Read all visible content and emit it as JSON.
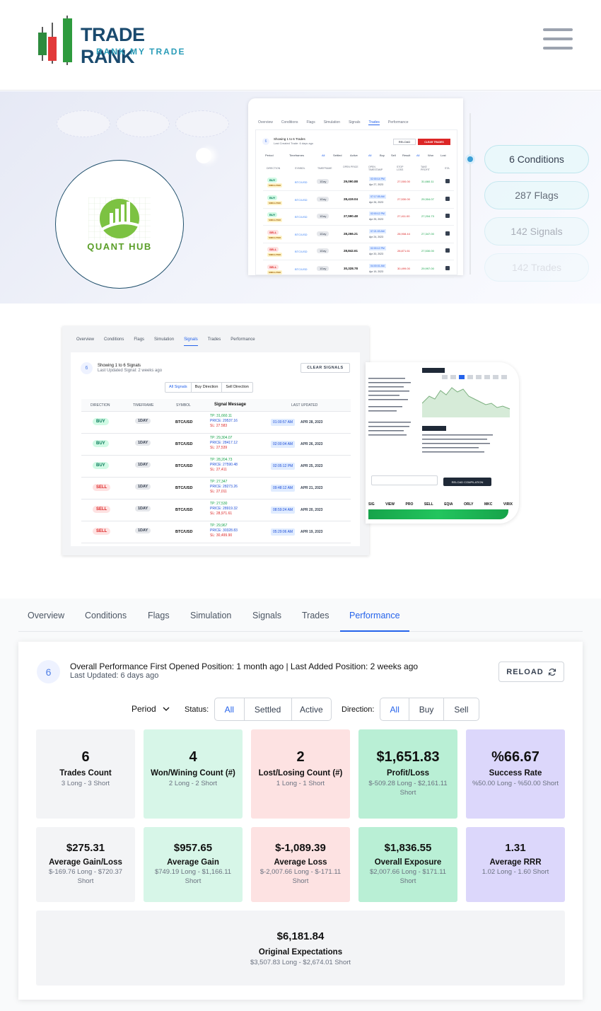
{
  "header": {
    "brand_name": "TRADE RANK",
    "brand_tagline": "RANK MY TRADE",
    "menu_icon": "hamburger-menu-icon"
  },
  "hero": {
    "partner_logo_text": "QUANT HUB",
    "pills": [
      "6 Conditions",
      "287 Flags",
      "142 Signals",
      "142 Trades"
    ],
    "trades_preview": {
      "tabs": [
        "Overview",
        "Conditions",
        "Flags",
        "Simulation",
        "Signals",
        "Trades",
        "Performance"
      ],
      "active_tab": "Trades",
      "count": "6",
      "title": "Showing 1 to 6 Trades",
      "subtitle": "Last Created Trade: 6 days ago",
      "reload_label": "RELOAD",
      "clear_label": "CLEAR TRADES",
      "filters": [
        "Period",
        "Timeframes",
        "All",
        "Settled",
        "Active",
        "All",
        "Buy",
        "Sell",
        "Result",
        "All",
        "Won",
        "Lost"
      ],
      "columns": [
        "DIRECTION",
        "SYMBOL",
        "TIMEFRAME",
        "OPEN PRICE",
        "OPEN TIMESTAMP",
        "STOP LOSS",
        "TAKE PROFIT",
        "STA"
      ],
      "rows": [
        {
          "dir": "BUY",
          "tag": "SIMULATED",
          "symbol": "BTC/USD",
          "tf": "1Day",
          "price": "29,090.88",
          "time": "02:00:14 PM",
          "date": "Apr 27, 2023",
          "sl": "27,000.00",
          "tp": "31,660.11"
        },
        {
          "dir": "BUY",
          "tag": "SIMULATED",
          "symbol": "BTC/USD",
          "tf": "1Day",
          "price": "28,419.04",
          "time": "07:17:05 AM",
          "date": "Apr 26, 2023",
          "sl": "27,530.00",
          "tp": "29,304.07"
        },
        {
          "dir": "BUY",
          "tag": "SIMULATED",
          "symbol": "BTC/USD",
          "tf": "1Day",
          "price": "27,590.48",
          "time": "02:00:12 PM",
          "date": "Apr 25, 2023",
          "sl": "27,411.00",
          "tp": "27,204.73"
        },
        {
          "dir": "SELL",
          "tag": "SIMULATED",
          "symbol": "BTC/USD",
          "tf": "1Day",
          "price": "28,266.21",
          "time": "07:21:03 AM",
          "date": "Apr 24, 2023",
          "sl": "28,908.44",
          "tp": "27,347.00"
        },
        {
          "dir": "SELL",
          "tag": "SIMULATED",
          "symbol": "BTC/USD",
          "tf": "1Day",
          "price": "28,842.61",
          "time": "02:00:12 PM",
          "date": "Apr 20, 2023",
          "sl": "28,871.61",
          "tp": "27,530.00"
        },
        {
          "dir": "SELL",
          "tag": "SIMULATED",
          "symbol": "BTC/USD",
          "tf": "1Day",
          "price": "30,328.78",
          "time": "04:00:01 AM",
          "date": "Apr 19, 2023",
          "sl": "30,499.00",
          "tp": "29,997.00"
        }
      ]
    }
  },
  "signals_preview": {
    "tabs": [
      "Overview",
      "Conditions",
      "Flags",
      "Simulation",
      "Signals",
      "Trades",
      "Performance"
    ],
    "active_tab": "Signals",
    "count": "6",
    "title": "Showing 1 to 6 Signals",
    "subtitle": "Last Updated Signal: 2 weeks ago",
    "clear_label": "CLEAR SIGNALS",
    "filters": [
      "All Signals",
      "Buy Direction",
      "Sell Direction"
    ],
    "columns": [
      "DIRECTION",
      "TIMEFRAME",
      "SYMBOL",
      "Signal Message",
      "LAST UPDATED"
    ],
    "rows": [
      {
        "dir": "BUY",
        "tf": "1DAY",
        "symbol": "BTC/USD",
        "tp": "TP: 31,660.11",
        "price": "PRICE: 29537.16",
        "sl": "SL: 27.583",
        "time": "01:00:57 AM",
        "date": "APR 28, 2023"
      },
      {
        "dir": "BUY",
        "tf": "1DAY",
        "symbol": "BTC/USD",
        "tp": "TP: 29,304.07",
        "price": "PRICE: 28417.12",
        "sl": "SL: 27,539",
        "time": "02:00:04 AM",
        "date": "APR 26, 2023"
      },
      {
        "dir": "BUY",
        "tf": "1DAY",
        "symbol": "BTC/USD",
        "tp": "TP: 28,204.73",
        "price": "PRICE: 27590.48",
        "sl": "SL: 27,411",
        "time": "02:05:12 PM",
        "date": "APR 25, 2023"
      },
      {
        "dir": "SELL",
        "tf": "1DAY",
        "symbol": "BTC/USD",
        "tp": "TP: 27,347",
        "price": "PRICE: 28273.26",
        "sl": "SL: 27,011",
        "time": "09:48:12 AM",
        "date": "APR 21, 2023"
      },
      {
        "dir": "SELL",
        "tf": "1DAY",
        "symbol": "BTC/USD",
        "tp": "TP: 27,530",
        "price": "PRICE: 28919.32",
        "sl": "SL: 28,971.61",
        "time": "08:59:24 AM",
        "date": "APR 20, 2023"
      },
      {
        "dir": "SELL",
        "tf": "1DAY",
        "symbol": "BTC/USD",
        "tp": "TP: 29,967",
        "price": "PRICE: 30328.83",
        "sl": "SL: 30,499.90",
        "time": "05:29:06 AM",
        "date": "APR 19, 2023"
      }
    ]
  },
  "chart_preview": {
    "tabs": [
      "SIG",
      "VIEW",
      "PRO",
      "SELL",
      "EQIA",
      "ORLY",
      "MKC",
      "VIRIX"
    ],
    "button_label": "RELOAD COMPILATION"
  },
  "performance": {
    "tabs": [
      "Overview",
      "Conditions",
      "Flags",
      "Simulation",
      "Signals",
      "Trades",
      "Performance"
    ],
    "active_tab": "Performance",
    "count": "6",
    "title": "Overall Performance First Opened Position: 1 month ago | Last Added Position: 2 weeks ago",
    "subtitle": "Last Updated: 6 days ago",
    "reload_label": "RELOAD",
    "period_label": "Period",
    "status_label": "Status:",
    "status_options": [
      "All",
      "Settled",
      "Active"
    ],
    "direction_label": "Direction:",
    "direction_options": [
      "All",
      "Buy",
      "Sell"
    ],
    "stats_row1": [
      {
        "value": "6",
        "label": "Trades Count",
        "detail": "3 Long - 3 Short"
      },
      {
        "value": "4",
        "label": "Won/Wining Count (#)",
        "detail": "2 Long - 2 Short"
      },
      {
        "value": "2",
        "label": "Lost/Losing Count (#)",
        "detail": "1 Long - 1 Short"
      },
      {
        "value": "$1,651.83",
        "label": "Profit/Loss",
        "detail": "$-509.28 Long - $2,161.11 Short"
      },
      {
        "value": "%66.67",
        "label": "Success Rate",
        "detail": "%50.00 Long - %50.00 Short"
      }
    ],
    "stats_row2": [
      {
        "value": "$275.31",
        "label": "Average Gain/Loss",
        "detail": "$-169.76 Long - $720.37 Short"
      },
      {
        "value": "$957.65",
        "label": "Average Gain",
        "detail": "$749.19 Long - $1,166.11 Short"
      },
      {
        "value": "$-1,089.39",
        "label": "Average Loss",
        "detail": "$-2,007.66 Long - $-171.11 Short"
      },
      {
        "value": "$1,836.55",
        "label": "Overall Exposure",
        "detail": "$2,007.66 Long - $171.11 Short"
      },
      {
        "value": "1.31",
        "label": "Average RRR",
        "detail": "1.02 Long - 1.60 Short"
      }
    ],
    "expectations": {
      "value": "$6,181.84",
      "label": "Original Expectations",
      "detail": "$3,507.83 Long - $2,674.01 Short"
    },
    "colors": {
      "accent": "#2563eb",
      "won": "#d7f6e8",
      "lost": "#fde2e2",
      "profit": "#b9efd5",
      "rate": "#dcd7fb",
      "neutral": "#f3f4f6"
    }
  }
}
